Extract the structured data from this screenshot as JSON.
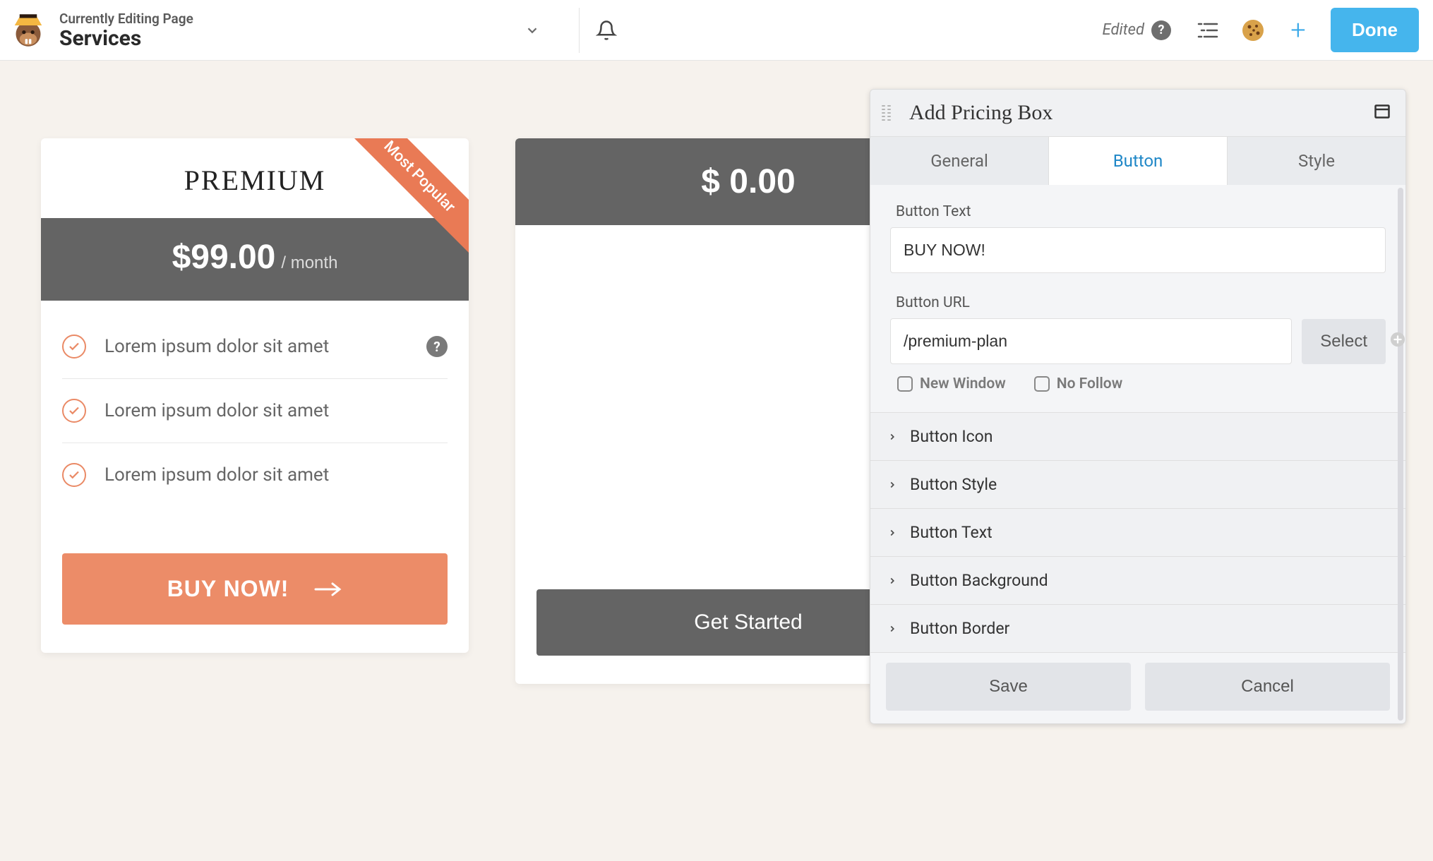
{
  "header": {
    "supertitle": "Currently Editing Page",
    "title": "Services",
    "edited_label": "Edited",
    "done_label": "Done"
  },
  "pricing": {
    "card1": {
      "ribbon": "Most Popular",
      "name": "PREMIUM",
      "price": "$99.00",
      "period": "/ month",
      "features": [
        "Lorem ipsum dolor sit amet",
        "Lorem ipsum dolor sit amet",
        "Lorem ipsum dolor sit amet"
      ],
      "cta": "BUY NOW!"
    },
    "card2": {
      "price": "$ 0.00",
      "cta": "Get Started"
    }
  },
  "panel": {
    "title": "Add Pricing Box",
    "tabs": {
      "general": "General",
      "button": "Button",
      "style": "Style"
    },
    "fields": {
      "button_text_label": "Button Text",
      "button_text_value": "BUY NOW!",
      "button_url_label": "Button URL",
      "button_url_value": "/premium-plan",
      "select_label": "Select",
      "new_window_label": "New Window",
      "no_follow_label": "No Follow"
    },
    "accordion": [
      "Button Icon",
      "Button Style",
      "Button Text",
      "Button Background",
      "Button Border"
    ],
    "footer": {
      "save": "Save",
      "cancel": "Cancel"
    }
  }
}
